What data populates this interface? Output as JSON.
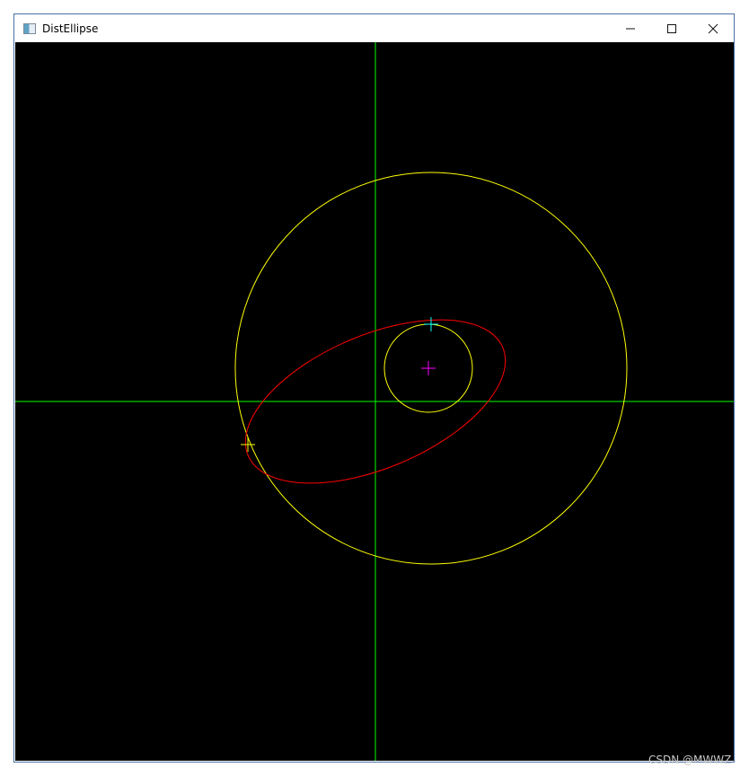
{
  "window": {
    "title": "DistEllipse",
    "icon": "app-window-icon",
    "controls": [
      "minimize-icon",
      "maximize-icon",
      "close-icon"
    ]
  },
  "canvas": {
    "background": "#000000",
    "axes_color": "#00ff00",
    "ellipse_color": "#ff0000",
    "circle_color": "#ffff00",
    "center_marker_color": "#ff00ff",
    "nearest_point_color": "#00ffff",
    "farthest_point_color": "#ffff00"
  },
  "watermark": "CSDN @MWWZ"
}
